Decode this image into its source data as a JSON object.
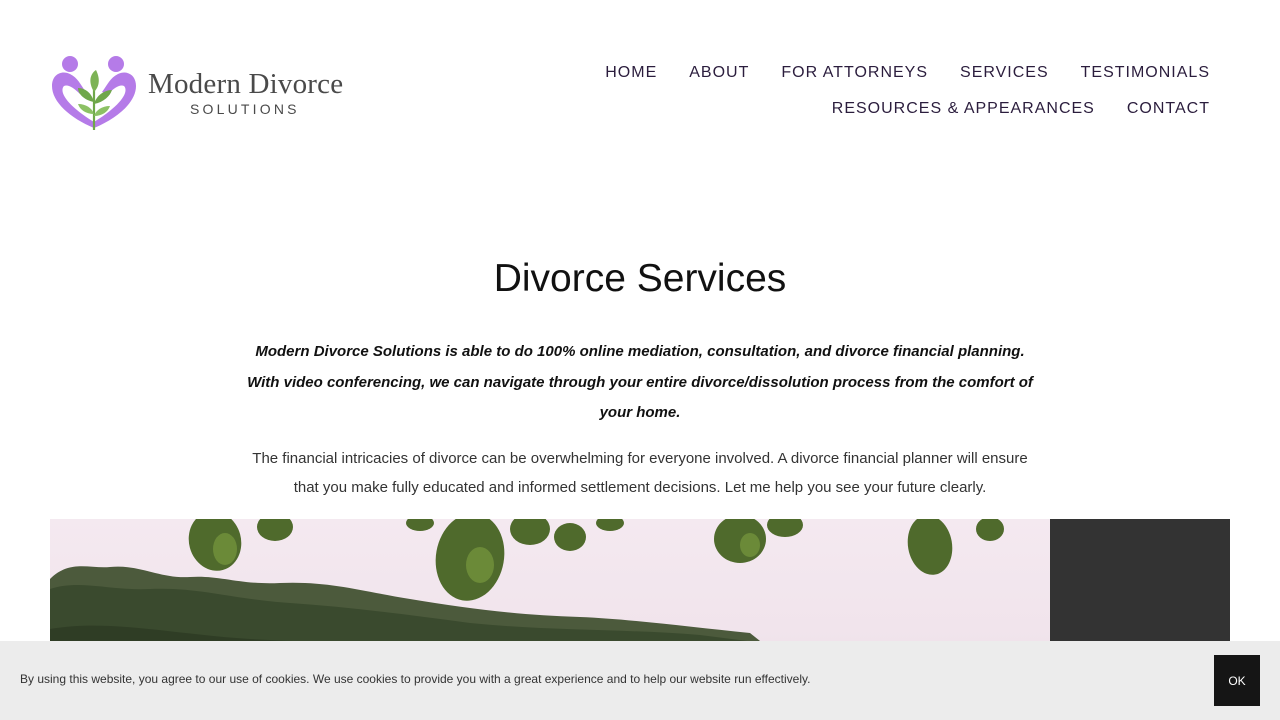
{
  "logo": {
    "name": "Modern Divorce",
    "sub": "SOLUTIONS",
    "icon": "heart-leaf-logo"
  },
  "nav": {
    "items": [
      {
        "label": "HOME"
      },
      {
        "label": "ABOUT"
      },
      {
        "label": "FOR ATTORNEYS"
      },
      {
        "label": "SERVICES"
      },
      {
        "label": "TESTIMONIALS"
      },
      {
        "label": "RESOURCES & APPEARANCES"
      },
      {
        "label": "CONTACT"
      }
    ]
  },
  "main": {
    "title": "Divorce Services",
    "intro": "Modern Divorce Solutions is able to do 100% online mediation, consultation, and divorce financial planning. With video conferencing, we can navigate through your entire divorce/dissolution process from the comfort of your home.",
    "body": "The financial intricacies of divorce can be overwhelming for everyone involved. A divorce financial planner will ensure that you make fully educated and informed settlement decisions. Let me help you see your future clearly."
  },
  "cookie": {
    "text": "By using this website, you agree to our use of cookies. We use cookies to provide you with a great experience and to help our website run effectively.",
    "ok_label": "OK"
  },
  "colors": {
    "nav_text": "#2b1d3d",
    "logo_purple": "#b57be8",
    "logo_green": "#6fa74a",
    "cookie_bg": "#ececec",
    "ok_button": "#151515"
  }
}
